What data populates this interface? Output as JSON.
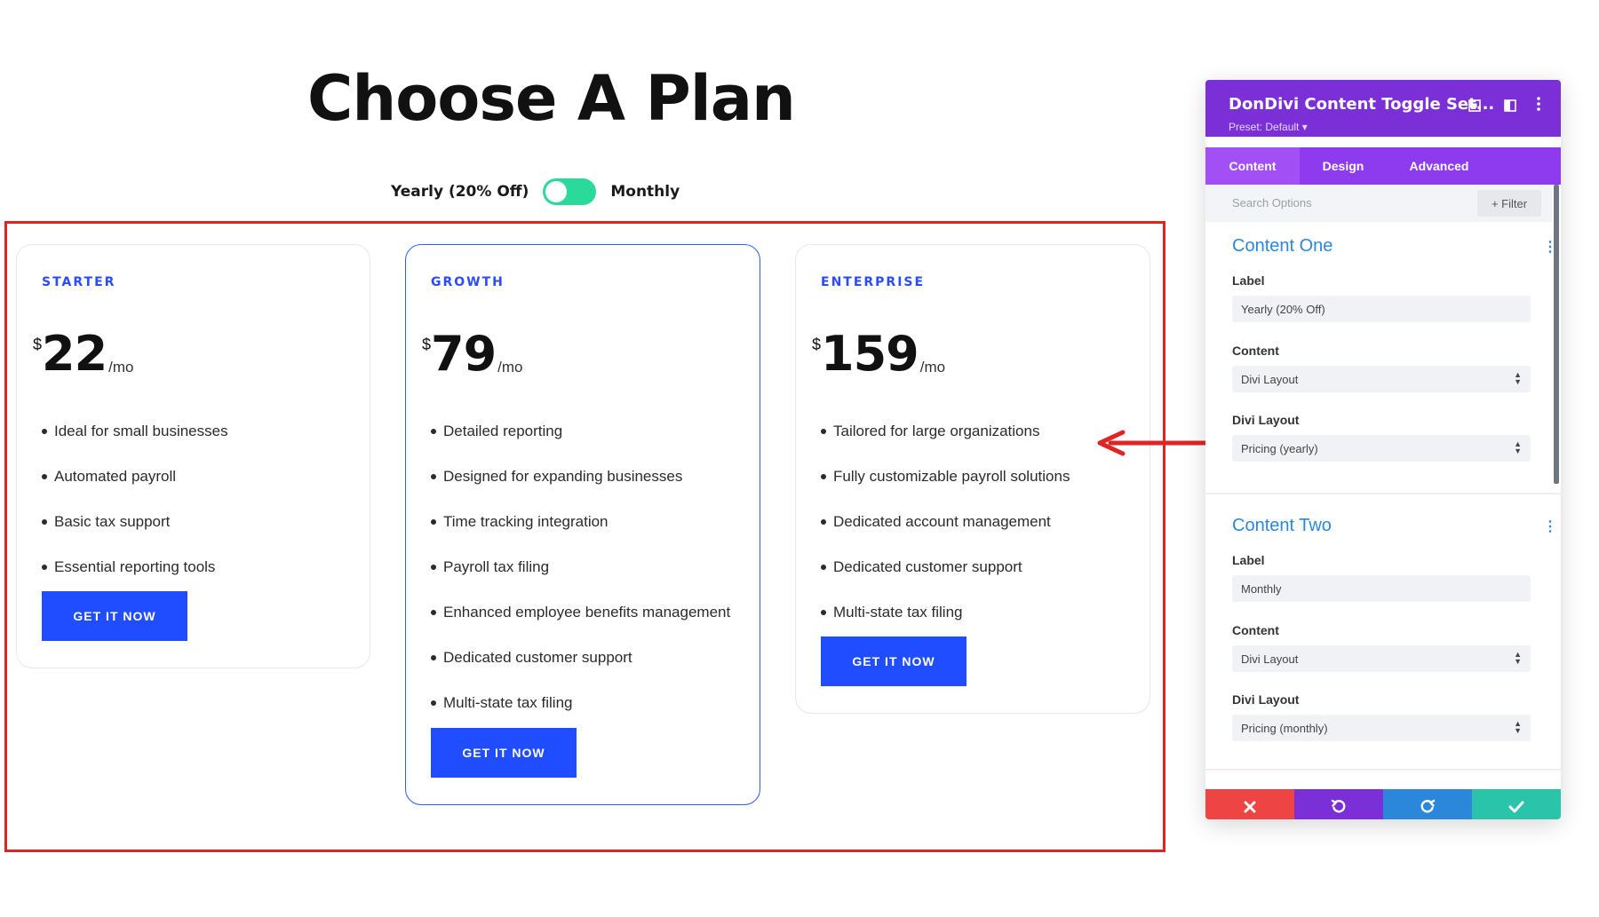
{
  "page": {
    "heading": "Choose A Plan",
    "toggle": {
      "left_label": "Yearly (20% Off)",
      "right_label": "Monthly",
      "accent": "#2bd99a"
    }
  },
  "plans": [
    {
      "name": "STARTER",
      "currency": "$",
      "price": "22",
      "period": "/mo",
      "features": [
        "Ideal for small businesses",
        "Automated payroll",
        "Basic tax support",
        "Essential reporting tools"
      ],
      "cta": "GET IT NOW"
    },
    {
      "name": "GROWTH",
      "currency": "$",
      "price": "79",
      "period": "/mo",
      "features": [
        "Detailed reporting",
        "Designed for expanding businesses",
        "Time tracking integration",
        "Payroll tax filing",
        "Enhanced employee benefits management",
        "Dedicated customer support",
        "Multi-state tax filing"
      ],
      "cta": "GET IT NOW"
    },
    {
      "name": "ENTERPRISE",
      "currency": "$",
      "price": "159",
      "period": "/mo",
      "features": [
        "Tailored for large organizations",
        "Fully customizable payroll solutions",
        "Dedicated account management",
        "Dedicated customer support",
        "Multi-state tax filing"
      ],
      "cta": "GET IT NOW"
    }
  ],
  "panel": {
    "title": "DonDivi Content Toggle Set...",
    "preset": "Preset: Default ▾",
    "tabs": [
      "Content",
      "Design",
      "Advanced"
    ],
    "search_placeholder": "Search Options",
    "filter_label": "+ Filter",
    "content_one": {
      "title": "Content One",
      "label_caption": "Label",
      "label_value": "Yearly (20% Off)",
      "content_caption": "Content",
      "content_value": "Divi Layout",
      "layout_caption": "Divi Layout",
      "layout_value": "Pricing (yearly)"
    },
    "content_two": {
      "title": "Content Two",
      "label_caption": "Label",
      "label_value": "Monthly",
      "content_caption": "Content",
      "content_value": "Divi Layout",
      "layout_caption": "Divi Layout",
      "layout_value": "Pricing (monthly)"
    },
    "footer_icons": [
      "close-icon",
      "undo-icon",
      "redo-icon",
      "check-icon"
    ],
    "colors": {
      "header": "#7b2fd6",
      "tabs": "#8e3bf0",
      "active_tab": "#a24ff5",
      "discard": "#ef4444",
      "undo": "#7b2fd6",
      "redo": "#2b87da",
      "save": "#29c4a9"
    }
  },
  "colors": {
    "primary_button": "#1f4dff",
    "highlight_frame": "#e02424",
    "arrow": "#e02424"
  }
}
